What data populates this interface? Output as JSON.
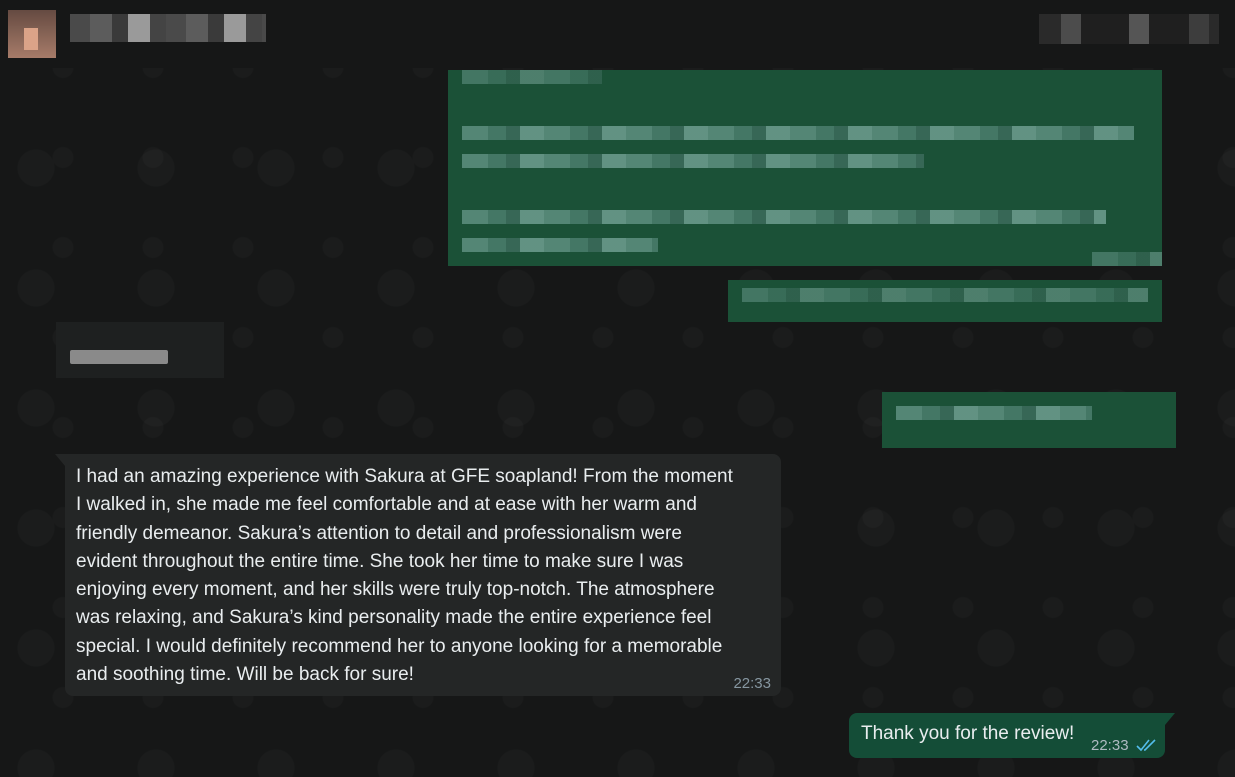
{
  "chat": {
    "incoming_message": {
      "text": "I had an amazing experience with Sakura at GFE soapland! From the moment\nI walked in, she made me feel comfortable and at ease with her warm and\nfriendly demeanor. Sakura’s attention to detail and professionalism were\nevident throughout the entire time. She took her time to make sure I was\nenjoying every moment, and her skills were truly top-notch. The atmosphere\nwas relaxing, and Sakura’s kind personality made the entire experience feel\nspecial. I would definitely recommend her to anyone looking for a memorable\nand soothing time. Will be back for sure!",
      "time": "22:33"
    },
    "outgoing_message": {
      "text": "Thank you for the review!",
      "time": "22:33",
      "status_icon": "double-check-read-icon"
    }
  },
  "colors": {
    "background": "#161717",
    "incoming_bubble": "#242626",
    "outgoing_bubble": "#144d37",
    "read_tick": "#53bdeb"
  }
}
